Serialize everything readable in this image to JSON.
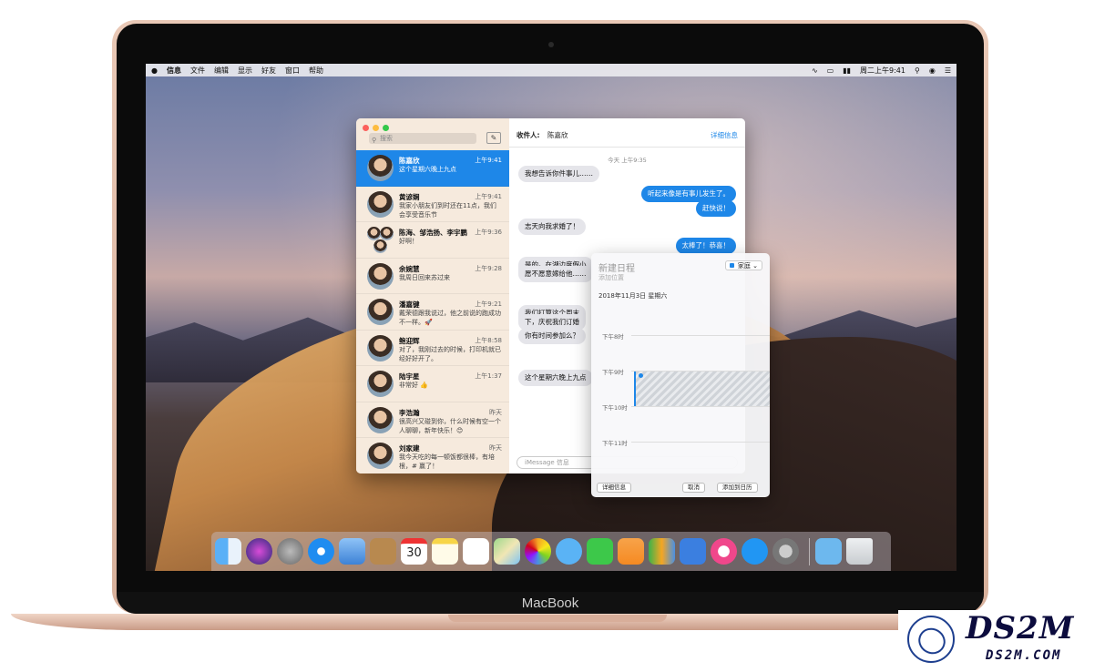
{
  "menubar": {
    "apple": "",
    "items": [
      "信息",
      "文件",
      "编辑",
      "显示",
      "好友",
      "窗口",
      "帮助"
    ],
    "datetime": "周二上午9:41"
  },
  "messages": {
    "search_placeholder": "搜索",
    "conversations": [
      {
        "name": "陈嘉欣",
        "time": "上午9:41",
        "preview": "这个星期六晚上九点",
        "active": true
      },
      {
        "name": "黄谚娴",
        "time": "上午9:41",
        "preview": "我家小朋友们到时还在11点，我们会享受音乐节",
        "active": false
      },
      {
        "name": "陈海、邹浩扬、李宇鹏",
        "time": "上午9:36",
        "preview": "好啊！",
        "active": false
      },
      {
        "name": "余婉慧",
        "time": "上午9:28",
        "preview": "我周日回来苏过来",
        "active": false
      },
      {
        "name": "潘嘉键",
        "time": "上午9:21",
        "preview": "戴荣德跟我说过，他之前说的跑成功不一样。🚀",
        "active": false
      },
      {
        "name": "鲍迎辉",
        "time": "上午8:58",
        "preview": "对了，我刚过去的时候，打印机就已经好好开了。",
        "active": false
      },
      {
        "name": "陆宇星",
        "time": "上午1:37",
        "preview": "非常好 👍",
        "active": false
      },
      {
        "name": "李浩瀚",
        "time": "昨天",
        "preview": "很高兴又碰到你，什么时候有空一个人聊聊，新年快乐！😊",
        "active": false
      },
      {
        "name": "刘家建",
        "time": "昨天",
        "preview": "我今天吃的每一顿饭都很棒，有培根，# 赢了！",
        "active": false
      }
    ],
    "chat": {
      "to_label": "收件人:",
      "to_name": "陈嘉欣",
      "details": "详细信息",
      "timestamp": "今天 上午9:35",
      "bubbles": [
        {
          "dir": "in",
          "text": "我想告诉你件事儿……"
        },
        {
          "dir": "out",
          "text": "听起来像是有事儿发生了。"
        },
        {
          "dir": "out",
          "text": "赶快说！"
        },
        {
          "dir": "in",
          "text": "志天向我求婚了！"
        },
        {
          "dir": "out",
          "text": "太棒了！恭喜！"
        },
        {
          "dir": "in",
          "text": "是的。在湖边度假小"
        },
        {
          "dir": "in",
          "text": "愿不愿意嫁给他……"
        },
        {
          "dir": "in",
          "text": "我们打算这个周末"
        },
        {
          "dir": "in",
          "text": "下，庆祝我们订婚"
        },
        {
          "dir": "in",
          "text": "你有时间参加么？"
        },
        {
          "dir": "in",
          "text": "这个星期六晚上九点"
        }
      ],
      "input_placeholder": "iMessage 信息"
    }
  },
  "calendar_popover": {
    "title": "新建日程",
    "location": "添加位置",
    "calendar": "家庭",
    "date": "2018年11月3日 星期六",
    "hours": [
      "下午8时",
      "下午9时",
      "下午10时",
      "下午11时"
    ],
    "buttons": {
      "details": "详细信息",
      "cancel": "取消",
      "add": "添加到日历"
    }
  },
  "dock": {
    "apps": [
      "finder-icon",
      "siri-icon",
      "launchpad-icon",
      "safari-icon",
      "mail-icon",
      "contacts-icon",
      "calendar-icon",
      "notes-icon",
      "reminders-icon",
      "maps-icon",
      "photos-icon",
      "messages-icon",
      "facetime-icon",
      "pages-icon",
      "numbers-icon",
      "keynote-icon",
      "itunes-icon",
      "appstore-icon",
      "preferences-icon",
      "downloads-icon",
      "trash-icon"
    ],
    "calendar_day": "30"
  },
  "laptop": {
    "label": "MacBook"
  },
  "watermark": {
    "main": "DS2M",
    "sub": "DS2M.COM"
  },
  "colors": {
    "accent": "#1e87e8",
    "bubble_in": "#e5e5ea"
  }
}
